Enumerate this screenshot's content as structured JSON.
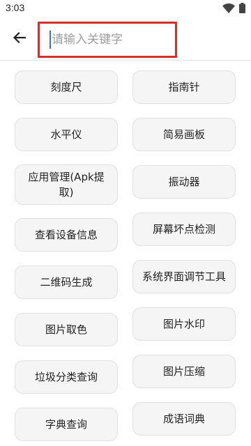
{
  "status_bar": {
    "time": "3:03",
    "icons": [
      "wifi-icon",
      "battery-icon"
    ]
  },
  "header": {
    "back_icon": "arrow-left-icon",
    "search": {
      "placeholder": "请输入关键字",
      "value": "",
      "highlight_color": "#d32f2f"
    }
  },
  "tools": {
    "left": [
      "刻度尺",
      "水平仪",
      "应用管理(Apk提取)",
      "查看设备信息",
      "二维码生成",
      "图片取色",
      "垃圾分类查询",
      "字典查询"
    ],
    "right": [
      "指南针",
      "简易画板",
      "振动器",
      "屏幕坏点检测",
      "系统界面调节工具",
      "图片水印",
      "图片压缩",
      "成语词典"
    ]
  }
}
